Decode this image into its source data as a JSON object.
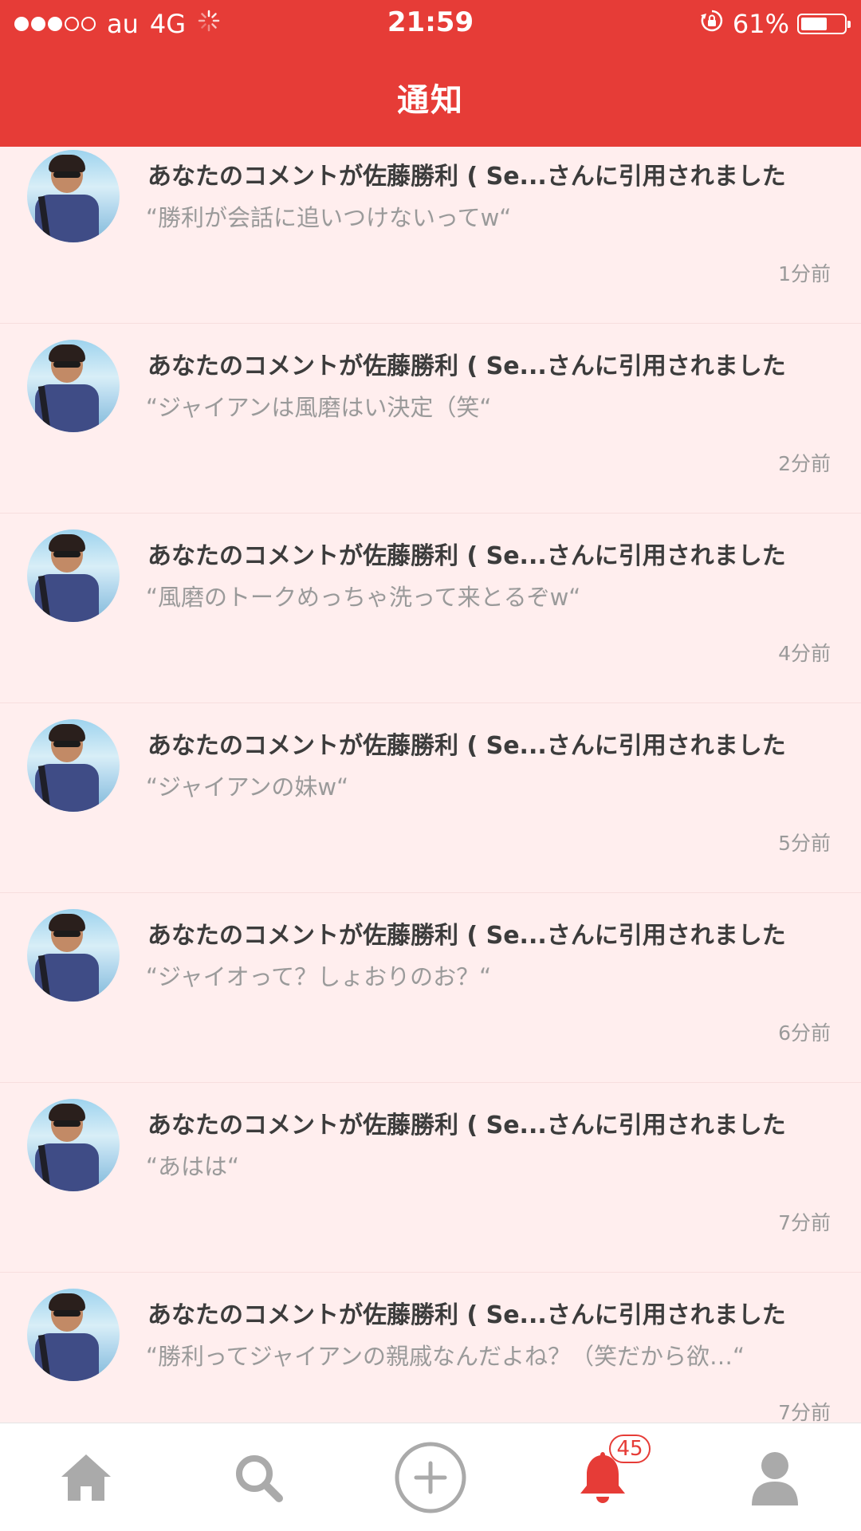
{
  "status_bar": {
    "carrier": "au",
    "network": "4G",
    "time": "21:59",
    "battery_percent": "61%",
    "battery_level": 0.61,
    "signal_bars_filled": 3,
    "signal_bars_total": 5
  },
  "header": {
    "title": "通知",
    "background_color": "#e63c37"
  },
  "notifications": [
    {
      "title": "あなたのコメントが佐藤勝利 ( Se...さんに引用されました",
      "quote": "“勝利が会話に追いつけないってw“",
      "time": "1分前"
    },
    {
      "title": "あなたのコメントが佐藤勝利 ( Se...さんに引用されました",
      "quote": "“ジャイアンは風磨はい決定（笑“",
      "time": "2分前"
    },
    {
      "title": "あなたのコメントが佐藤勝利 ( Se...さんに引用されました",
      "quote": "“風磨のトークめっちゃ洗って来とるぞw“",
      "time": "4分前"
    },
    {
      "title": "あなたのコメントが佐藤勝利 ( Se...さんに引用されました",
      "quote": "“ジャイアンの妹w“",
      "time": "5分前"
    },
    {
      "title": "あなたのコメントが佐藤勝利 ( Se...さんに引用されました",
      "quote": "“ジャイオって？しょおりのお？“",
      "time": "6分前"
    },
    {
      "title": "あなたのコメントが佐藤勝利 ( Se...さんに引用されました",
      "quote": "“あはは“",
      "time": "7分前"
    },
    {
      "title": "あなたのコメントが佐藤勝利 ( Se...さんに引用されました",
      "quote": "“勝利ってジャイアンの親戚なんだよね？（笑だから欲…“",
      "time": "7分前"
    }
  ],
  "tab_bar": {
    "tabs": [
      {
        "name": "home",
        "icon": "home-icon",
        "active": false
      },
      {
        "name": "search",
        "icon": "search-icon",
        "active": false
      },
      {
        "name": "post",
        "icon": "plus-circle-icon",
        "active": false
      },
      {
        "name": "notifications",
        "icon": "bell-icon",
        "active": true,
        "badge": "45"
      },
      {
        "name": "profile",
        "icon": "person-icon",
        "active": false
      }
    ],
    "active_color": "#e63c37",
    "inactive_color": "#aaaaaa"
  }
}
